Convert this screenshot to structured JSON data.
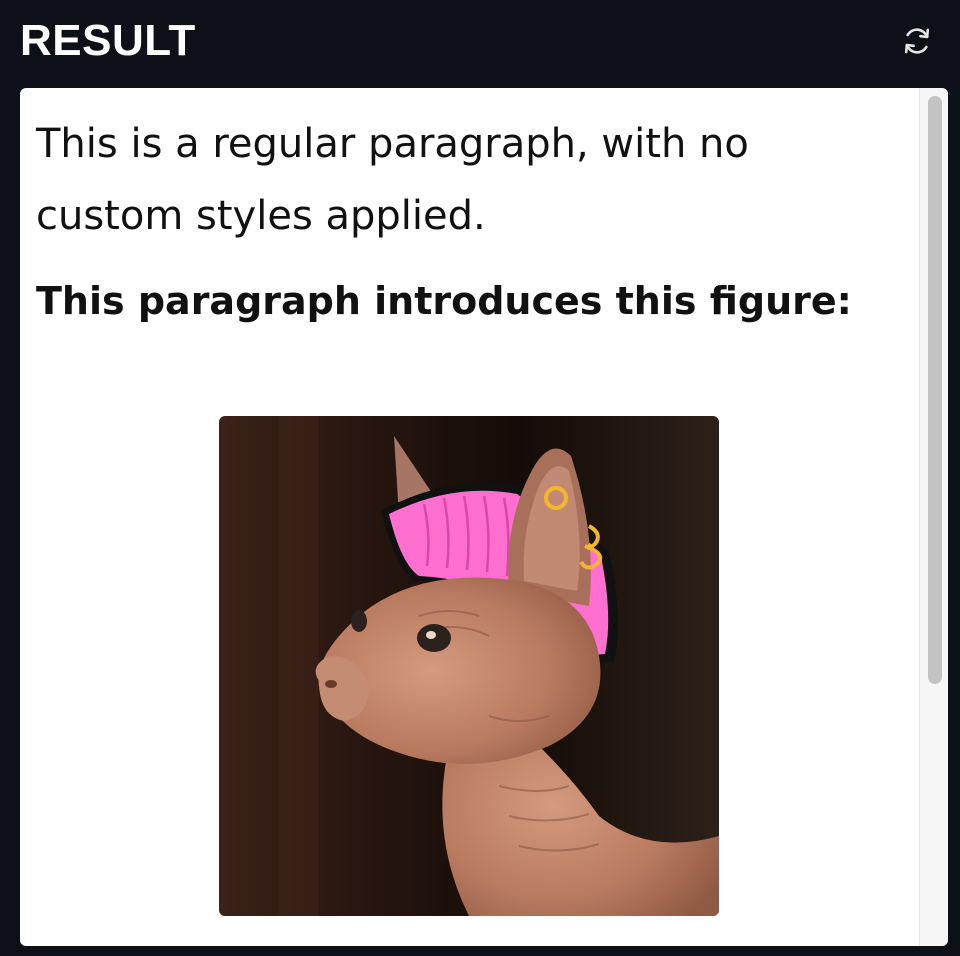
{
  "header": {
    "title": "RESULT",
    "refresh_icon": "refresh-icon"
  },
  "content": {
    "paragraph_regular": "This is a regular paragraph, with no custom styles applied.",
    "paragraph_bold": "This paragraph introduces this figure:"
  },
  "figure": {
    "icon": "hairless-cat-with-pink-mohawk"
  },
  "colors": {
    "page_bg": "#0d1117",
    "panel_bg": "#ffffff",
    "mohawk_pink": "#ff6fd0",
    "earring_gold": "#f2b630"
  }
}
